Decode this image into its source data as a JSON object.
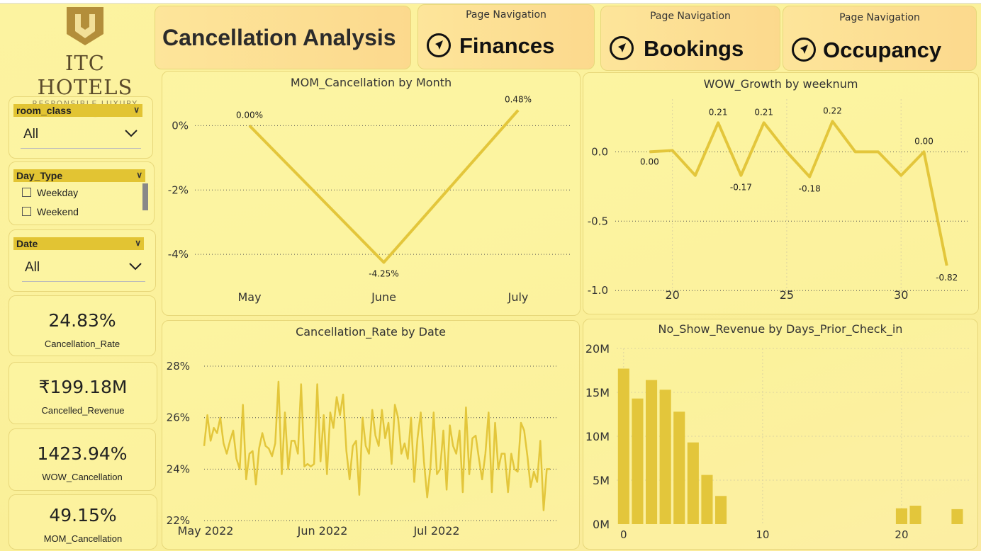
{
  "logo": {
    "brand": "ITC HOTELS",
    "tagline": "RESPONSIBLE LUXURY"
  },
  "header": {
    "title": "Cancellation Analysis"
  },
  "nav": [
    {
      "small": "Page Navigation",
      "label": "Finances"
    },
    {
      "small": "Page Navigation",
      "label": "Bookings"
    },
    {
      "small": "Page Navigation",
      "label": "Occupancy"
    }
  ],
  "slicers": {
    "room_class": {
      "title": "room_class",
      "value": "All"
    },
    "day_type": {
      "title": "Day_Type",
      "options": [
        "Weekday",
        "Weekend"
      ]
    },
    "date": {
      "title": "Date",
      "value": "All"
    }
  },
  "kpis": [
    {
      "value": "24.83%",
      "label": "Cancellation_Rate"
    },
    {
      "value": "₹199.18M",
      "label": "Cancelled_Revenue"
    },
    {
      "value": "1423.94%",
      "label": "WOW_Cancellation"
    },
    {
      "value": "49.15%",
      "label": "MOM_Cancellation"
    }
  ],
  "colors": {
    "accent": "#e3c63b",
    "grid": "#555555"
  },
  "chart_data": [
    {
      "id": "mom",
      "type": "line",
      "title": "MOM_Cancellation by Month",
      "categories": [
        "May",
        "June",
        "July"
      ],
      "values": [
        0.0,
        -4.25,
        0.48
      ],
      "data_labels": [
        "0.00%",
        "-4.25%",
        "0.48%"
      ],
      "yticks": [
        "0%",
        "-2%",
        "-4%"
      ],
      "ylim": [
        -4.9,
        1.0
      ],
      "grid": true
    },
    {
      "id": "wow",
      "type": "line",
      "title": "WOW_Growth by weeknum",
      "x": [
        19,
        20,
        21,
        22,
        23,
        24,
        25,
        26,
        27,
        28,
        29,
        30,
        31,
        32
      ],
      "values": [
        0.0,
        0.01,
        -0.17,
        0.21,
        -0.17,
        0.21,
        0.0,
        -0.18,
        0.22,
        0.0,
        0.0,
        -0.17,
        0.0,
        -0.82
      ],
      "data_labels": [
        "0.00",
        "",
        "",
        "0.21",
        "-0.17",
        "0.21",
        "",
        "-0.18",
        "0.22",
        "",
        "",
        "",
        "0.00",
        "-0.82"
      ],
      "yticks": [
        "0.0",
        "-0.5",
        "-1.0"
      ],
      "xticks": [
        "20",
        "25",
        "30"
      ],
      "xlim": [
        17.5,
        33
      ],
      "ylim": [
        -1.05,
        0.38
      ],
      "grid": true
    },
    {
      "id": "rate",
      "type": "line",
      "title": "Cancellation_Rate by Date",
      "xticks": [
        "May 2022",
        "Jun 2022",
        "Jul 2022"
      ],
      "yticks": [
        "28%",
        "26%",
        "24%",
        "22%"
      ],
      "ylim": [
        22,
        28.8
      ],
      "values": [
        24.9,
        26.1,
        25.1,
        25.6,
        25.4,
        26.0,
        25.0,
        24.6,
        25.1,
        25.5,
        24.4,
        24.0,
        26.5,
        23.6,
        24.6,
        24.7,
        23.4,
        24.8,
        25.4,
        24.9,
        24.8,
        24.5,
        25.0,
        27.4,
        23.8,
        26.2,
        24.0,
        25.1,
        25.1,
        24.6,
        27.3,
        24.1,
        24.2,
        24.1,
        24.2,
        27.3,
        24.3,
        26.1,
        23.8,
        26.2,
        25.6,
        26.8,
        26.1,
        26.9,
        24.7,
        23.6,
        24.9,
        25.1,
        23.0,
        26.0,
        24.9,
        24.6,
        26.3,
        25.3,
        24.9,
        26.3,
        25.2,
        25.8,
        24.2,
        26.5,
        26.0,
        24.6,
        25.0,
        24.4,
        26.0,
        23.5,
        25.2,
        26.2,
        24.3,
        22.9,
        24.1,
        26.2,
        23.8,
        24.0,
        25.5,
        23.2,
        25.7,
        24.9,
        24.6,
        25.5,
        23.1,
        26.4,
        23.8,
        25.2,
        25.3,
        24.4,
        23.6,
        24.6,
        26.2,
        23.1,
        25.8,
        24.0,
        24.6,
        24.6,
        23.1,
        24.6,
        24.0,
        23.9,
        25.8,
        25.5,
        24.5,
        23.3,
        23.9,
        23.5,
        25.1,
        22.4,
        24.0,
        24.0
      ]
    },
    {
      "id": "noshow",
      "type": "bar",
      "title": "No_Show_Revenue by Days_Prior_Check_in",
      "x": [
        0,
        1,
        2,
        3,
        4,
        5,
        6,
        7,
        20,
        21,
        24
      ],
      "values": [
        17.7,
        14.3,
        16.4,
        15.3,
        12.8,
        9.3,
        5.6,
        3.2,
        1.8,
        2.1,
        1.7
      ],
      "unit": "M",
      "yticks": [
        "20M",
        "15M",
        "10M",
        "5M",
        "0M"
      ],
      "xticks": [
        "0",
        "10",
        "20"
      ],
      "xlim": [
        -0.5,
        25
      ],
      "ylim": [
        0,
        20
      ],
      "grid": true
    }
  ]
}
